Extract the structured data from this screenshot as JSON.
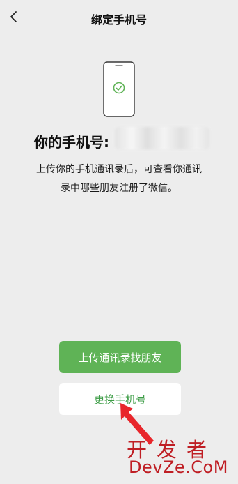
{
  "header": {
    "title": "绑定手机号",
    "back_icon": "chevron-left-icon"
  },
  "illustration": {
    "icon": "phone-verified-icon",
    "accent_color": "#5fb356"
  },
  "number": {
    "label": "你的手机号:"
  },
  "description": {
    "line1": "上传你的手机通讯录后，可查看你通讯",
    "line2": "录中哪些朋友注册了微信。"
  },
  "actions": {
    "upload_label": "上传通讯录找朋友",
    "change_label": "更换手机号",
    "primary_color": "#5fb356",
    "secondary_text_color": "#3e9d47"
  },
  "annotation": {
    "arrow_color": "#e8262b"
  },
  "watermark": {
    "line1": "开发者",
    "line2": "DevZe.CoM",
    "color": "#bf1e24"
  }
}
